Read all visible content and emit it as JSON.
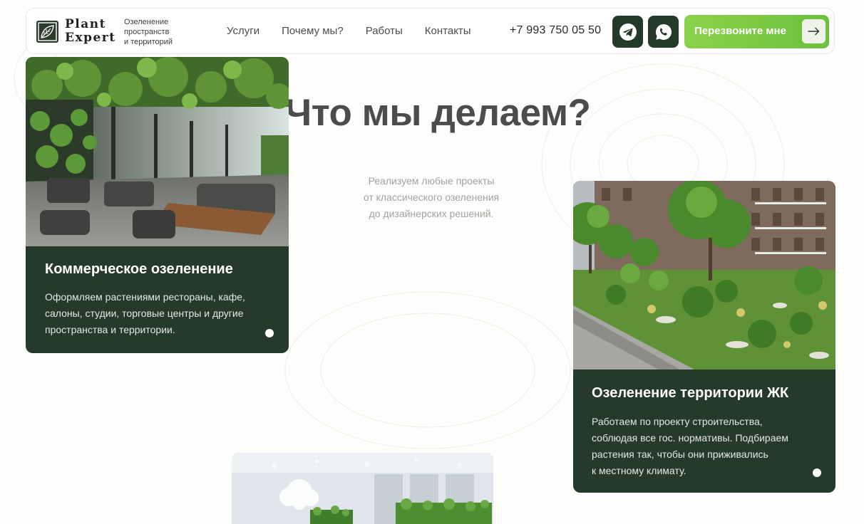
{
  "header": {
    "logo": {
      "line1": "Plant",
      "line2": "Expert",
      "icon": "leaf-logo-icon"
    },
    "caption": [
      "Озеленение",
      "пространств",
      "и территорий"
    ],
    "nav": [
      "Услуги",
      "Почему мы?",
      "Работы",
      "Контакты"
    ],
    "phone": "+7 993 750 05 50",
    "social": [
      {
        "icon": "telegram-icon"
      },
      {
        "icon": "whatsapp-icon"
      }
    ],
    "cta": {
      "label": "Перезвоните мне",
      "icon": "arrow-right-icon"
    }
  },
  "hero": {
    "heading": "Что мы делаем?",
    "subtext": [
      "Реализуем любые проекты",
      "от классического озеленения",
      "до дизайнерских решений."
    ]
  },
  "cards": [
    {
      "title": "Коммерческое озеленение",
      "description": [
        "Оформляем растениями рестораны, кафе,",
        "салоны, студии, торговые центры и другие",
        "пространства и территории."
      ]
    },
    {
      "title": "Озеленение территории ЖК",
      "description": [
        "Работаем по проекту строительства,",
        "соблюдая все гос. нормативы. Подбираем",
        "растения так, чтобы они приживались",
        "к местному климату."
      ]
    }
  ],
  "colors": {
    "card_bg": "#253a2a",
    "accent_green": "#7cc944",
    "social_bg": "#233a2b",
    "heading": "#4a4d4a"
  }
}
